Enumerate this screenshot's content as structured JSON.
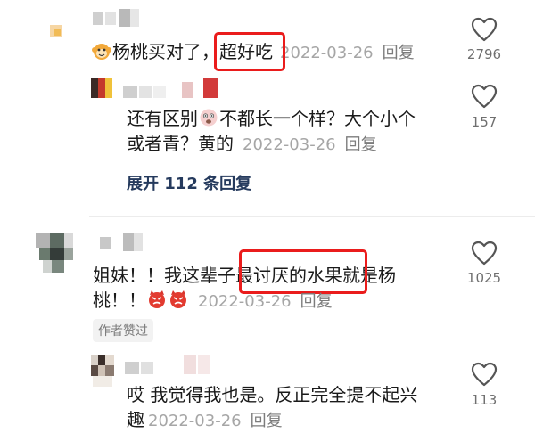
{
  "comments": [
    {
      "text_before": "杨桃买对了，",
      "text_highlight": "超好吃",
      "timestamp": "2022-03-26",
      "reply_label": "回复",
      "likes": "2796"
    },
    {
      "text_line1_before": "还有区别",
      "text_line1_after": "不都长一个样？大个小个",
      "text_line2": "或者青？黄的",
      "timestamp": "2022-03-26",
      "reply_label": "回复",
      "likes": "157",
      "expand_label": "展开 112 条回复"
    },
    {
      "text_line1_before": "姐妹！！我这辈子",
      "text_highlight": "最讨厌的水果就",
      "text_line1_after": "是杨",
      "text_line2": "桃！！",
      "timestamp": "2022-03-26",
      "reply_label": "回复",
      "likes": "1025",
      "badge": "作者赞过"
    },
    {
      "text_line1": "哎 我觉得我也是。反正完全提不起兴",
      "text_line2": "趣",
      "timestamp": "2022-03-26",
      "reply_label": "回复",
      "likes": "113"
    }
  ],
  "colors": {
    "highlight_box": "#ea1c1c",
    "timestamp": "#a6a6a6",
    "expand_link": "#253a5d"
  },
  "icons": [
    "heart-outline-icon",
    "monkey-emoji",
    "surprised-face-emoji",
    "angry-devil-emoji"
  ]
}
